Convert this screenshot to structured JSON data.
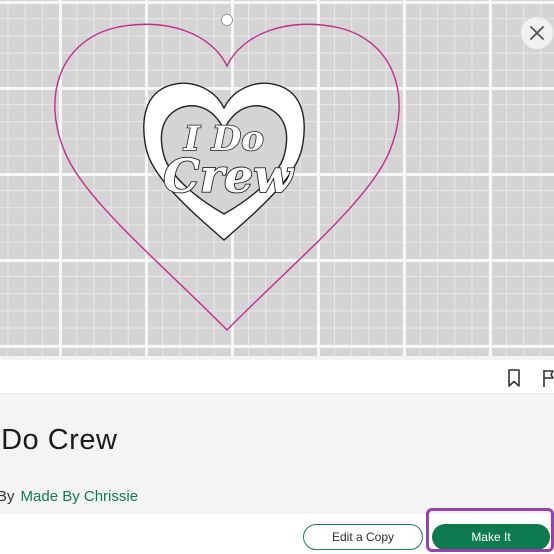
{
  "design": {
    "text_line_1": "I Do",
    "text_line_2": "Crew"
  },
  "toolbar": {
    "close_icon": "close-icon",
    "bookmark_icon": "bookmark-icon",
    "flag_icon": "flag-icon"
  },
  "project": {
    "title": "I Do Crew",
    "by_label": "By",
    "author": "Made By Chrissie"
  },
  "actions": {
    "edit_copy_label": "Edit a Copy",
    "make_it_label": "Make It"
  },
  "colors": {
    "accent_green": "#0e7a4f",
    "cut_line_pink": "#c42a8c",
    "highlight_purple": "#9a3fb0"
  }
}
